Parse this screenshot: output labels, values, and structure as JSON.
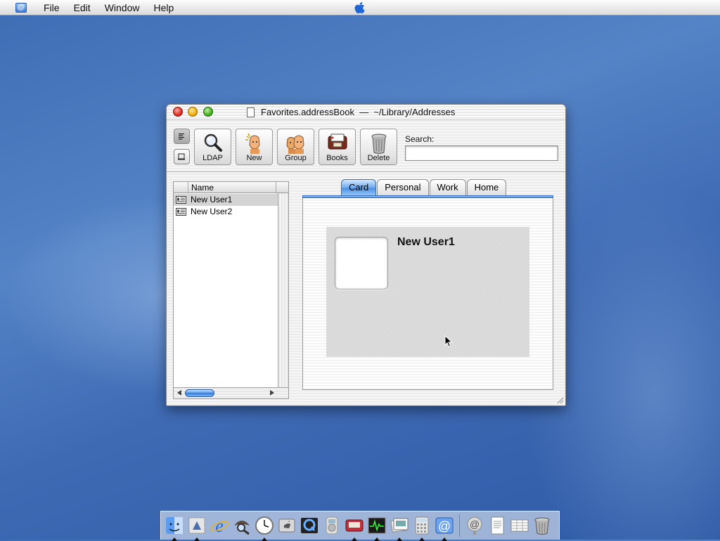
{
  "menubar": {
    "items": [
      "File",
      "Edit",
      "Window",
      "Help"
    ]
  },
  "window": {
    "title": "Favorites.addressBook",
    "separator": "—",
    "path": "~/Library/Addresses"
  },
  "toolbar": {
    "buttons": [
      {
        "label": "LDAP",
        "icon": "magnifier-icon"
      },
      {
        "label": "New",
        "icon": "new-person-icon"
      },
      {
        "label": "Group",
        "icon": "group-icon"
      },
      {
        "label": "Books",
        "icon": "books-icon"
      },
      {
        "label": "Delete",
        "icon": "trash-icon"
      }
    ],
    "search": {
      "label": "Search:",
      "value": "",
      "placeholder": ""
    }
  },
  "list": {
    "column": "Name",
    "rows": [
      {
        "name": "New User1",
        "selected": true
      },
      {
        "name": "New User2",
        "selected": false
      }
    ]
  },
  "tabs": [
    "Card",
    "Personal",
    "Work",
    "Home"
  ],
  "active_tab": "Card",
  "card": {
    "name": "New User1"
  },
  "dock": {
    "items": [
      "finder",
      "mail-stamp",
      "internet-explorer",
      "sherlock",
      "clock",
      "system-preferences",
      "quicktime",
      "itunes",
      "address-book-books",
      "process-viewer",
      "preview",
      "calculator",
      "mail",
      "document-1",
      "document-2",
      "document-3",
      "trash"
    ]
  },
  "colors": {
    "accent": "#4a8fe6",
    "selection": "#d4d4d4",
    "desktop": "#4a76bd"
  }
}
